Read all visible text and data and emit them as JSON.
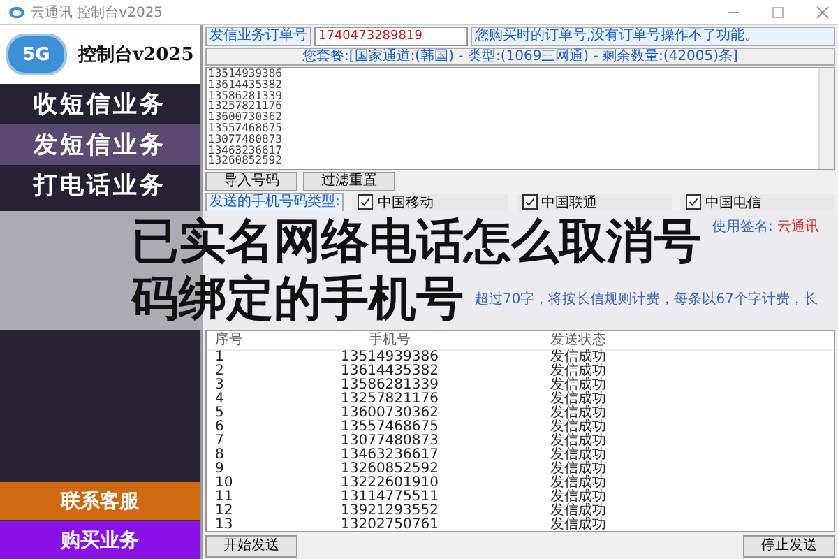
{
  "window": {
    "title": "云通讯 控制台v2025"
  },
  "sidebar": {
    "logo_text": "5G",
    "brand": "控制台v2025",
    "items": [
      {
        "label": "收短信业务",
        "selected": false
      },
      {
        "label": "发短信业务",
        "selected": true
      },
      {
        "label": "打电话业务",
        "selected": false
      }
    ],
    "bottom_buttons": [
      {
        "label": "联系客服",
        "color": "#d06a10"
      },
      {
        "label": "购买业务",
        "color": "#8a10e8"
      }
    ]
  },
  "order": {
    "label": "发信业务订单号",
    "value": "1740473289819",
    "hint": "您购买时的订单号,没有订单号操作不了功能。"
  },
  "package": "您套餐:[国家通道:(韩国) - 类型:(1069三网通) - 剩余数量:(42005)条]",
  "numbers": [
    "13514939386",
    "13614435382",
    "13586281339",
    "13257821176",
    "13600730362",
    "13557468675",
    "13077480873",
    "13463236617",
    "13260852592"
  ],
  "number_buttons": [
    "导入号码",
    "过滤重置"
  ],
  "carrier_label": "发送的手机号码类型:",
  "carriers": [
    {
      "label": "中国移动",
      "checked": true
    },
    {
      "label": "中国联通",
      "checked": true
    },
    {
      "label": "中国电信",
      "checked": true
    }
  ],
  "signature": {
    "label": "使用签名:",
    "value": "云通讯"
  },
  "message_hint": "超过70字，将按长信规则计费，每条以67个字计费，长",
  "table": {
    "columns": [
      "序号",
      "手机号",
      "发送状态"
    ],
    "rows": [
      [
        "1",
        "13514939386",
        "发信成功"
      ],
      [
        "2",
        "13614435382",
        "发信成功"
      ],
      [
        "3",
        "13586281339",
        "发信成功"
      ],
      [
        "4",
        "13257821176",
        "发信成功"
      ],
      [
        "5",
        "13600730362",
        "发信成功"
      ],
      [
        "6",
        "13557468675",
        "发信成功"
      ],
      [
        "7",
        "13077480873",
        "发信成功"
      ],
      [
        "8",
        "13463236617",
        "发信成功"
      ],
      [
        "9",
        "13260852592",
        "发信成功"
      ],
      [
        "10",
        "13222601910",
        "发信成功"
      ],
      [
        "11",
        "13114775511",
        "发信成功"
      ],
      [
        "12",
        "13921293552",
        "发信成功"
      ],
      [
        "13",
        "13202750761",
        "发信成功"
      ]
    ]
  },
  "actions": [
    "开始发送",
    "停止发送"
  ],
  "headline_lines": [
    "已实名网络电话怎么取消号",
    "码绑定的手机号"
  ]
}
